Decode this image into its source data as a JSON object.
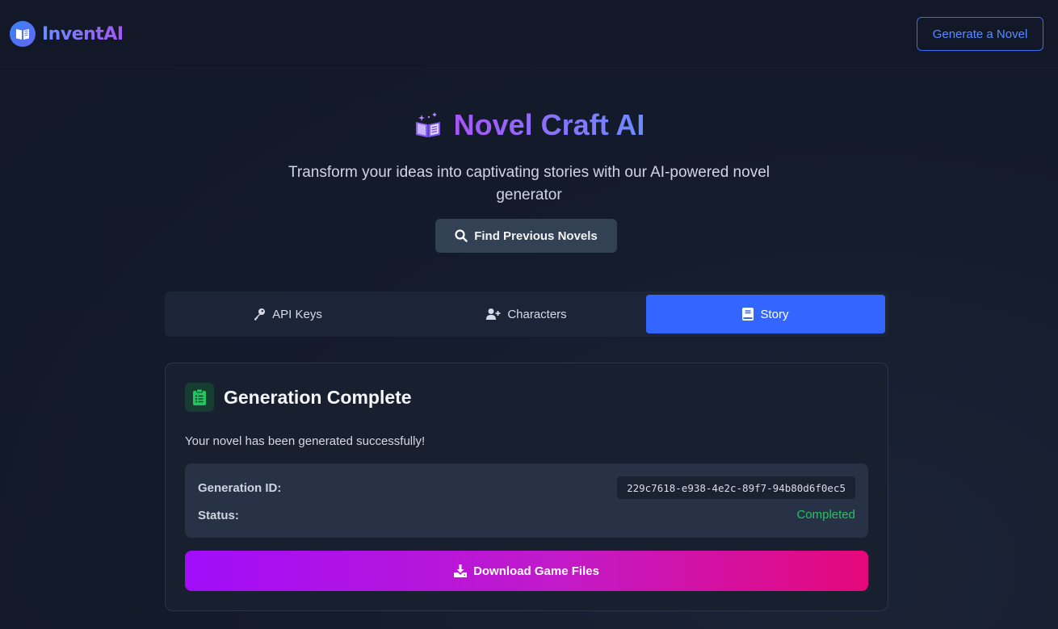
{
  "header": {
    "brand_name": "InventAI",
    "brand_icon": "open-book-icon",
    "generate_button": "Generate a Novel"
  },
  "hero": {
    "title": "Novel Craft AI",
    "title_icon": "magic-book-icon",
    "subtitle": "Transform your ideas into captivating stories with our AI-powered novel generator",
    "find_button": "Find Previous Novels",
    "find_icon": "search-icon"
  },
  "tabs": [
    {
      "label": "API Keys",
      "icon": "key-icon",
      "active": false
    },
    {
      "label": "Characters",
      "icon": "user-plus-icon",
      "active": false
    },
    {
      "label": "Story",
      "icon": "book-icon",
      "active": true
    }
  ],
  "result": {
    "title": "Generation Complete",
    "icon": "clipboard-list-icon",
    "message": "Your novel has been generated successfully!",
    "generation_id_label": "Generation ID:",
    "generation_id": "229c7618-e938-4e2c-89f7-94b80d6f0ec5",
    "status_label": "Status:",
    "status": "Completed",
    "download_button": "Download Game Files",
    "download_icon": "download-icon"
  },
  "colors": {
    "accent": "#3366ff",
    "success": "#22c55e",
    "gradient_start": "#a10dfa",
    "gradient_end": "#e5087a"
  }
}
